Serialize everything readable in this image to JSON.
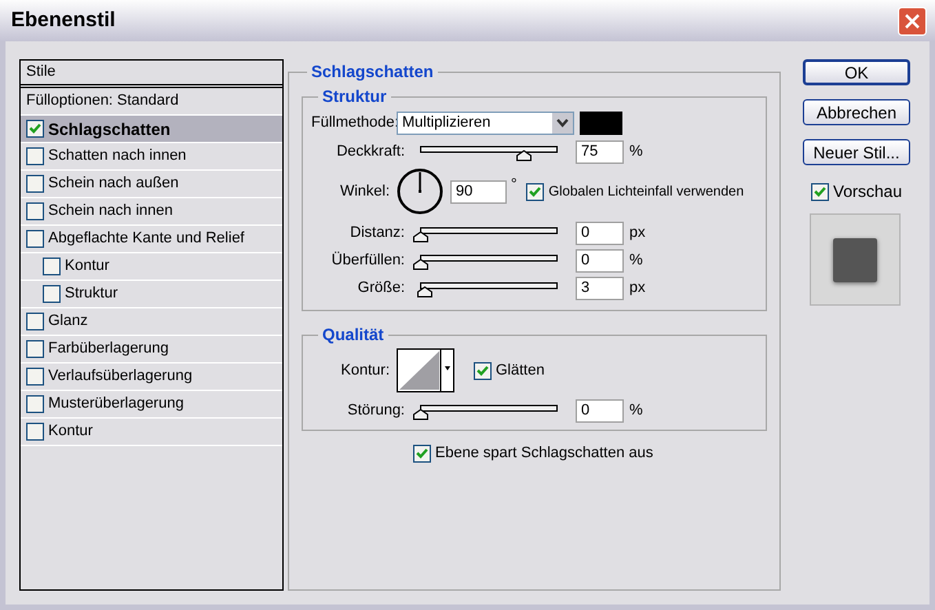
{
  "window": {
    "title": "Ebenenstil"
  },
  "styles_list": {
    "header": "Stile",
    "items": [
      {
        "kind": "plain",
        "label": "Fülloptionen: Standard",
        "selected": false
      },
      {
        "kind": "check",
        "label": "Schlagschatten",
        "checked": true,
        "selected": true
      },
      {
        "kind": "check",
        "label": "Schatten nach innen",
        "checked": false,
        "selected": false
      },
      {
        "kind": "check",
        "label": "Schein nach außen",
        "checked": false,
        "selected": false
      },
      {
        "kind": "check",
        "label": "Schein nach innen",
        "checked": false,
        "selected": false
      },
      {
        "kind": "check",
        "label": "Abgeflachte Kante und Relief",
        "checked": false,
        "selected": false,
        "children": [
          {
            "kind": "check",
            "label": "Kontur",
            "checked": false,
            "selected": false
          },
          {
            "kind": "check",
            "label": "Struktur",
            "checked": false,
            "selected": false
          }
        ]
      },
      {
        "kind": "check",
        "label": "Glanz",
        "checked": false,
        "selected": false
      },
      {
        "kind": "check",
        "label": "Farbüberlagerung",
        "checked": false,
        "selected": false
      },
      {
        "kind": "check",
        "label": "Verlaufsüberlagerung",
        "checked": false,
        "selected": false
      },
      {
        "kind": "check",
        "label": "Musterüberlagerung",
        "checked": false,
        "selected": false
      },
      {
        "kind": "check",
        "label": "Kontur",
        "checked": false,
        "selected": false
      }
    ]
  },
  "panel": {
    "title": "Schlagschatten",
    "structure": {
      "title": "Struktur",
      "blend_mode": {
        "label": "Füllmethode:",
        "value": "Multiplizieren",
        "color": "#000000"
      },
      "opacity": {
        "label": "Deckkraft:",
        "level": 0.75,
        "value": "75",
        "unit": "%"
      },
      "angle": {
        "label": "Winkel:",
        "value": "90",
        "unit": "°",
        "global_light": {
          "label": "Globalen Lichteinfall verwenden",
          "checked": true
        }
      },
      "sliders": [
        {
          "label": "Distanz:",
          "level": 0,
          "value": "0",
          "unit": "px"
        },
        {
          "label": "Überfüllen:",
          "level": 0,
          "value": "0",
          "unit": "%"
        },
        {
          "label": "Größe:",
          "level": 0.03,
          "value": "3",
          "unit": "px"
        }
      ]
    },
    "quality": {
      "title": "Qualität",
      "contour": {
        "label": "Kontur:"
      },
      "antialias": {
        "label": "Glätten",
        "checked": true
      },
      "noise": {
        "label": "Störung:",
        "level": 0,
        "value": "0",
        "unit": "%"
      }
    },
    "knockout": {
      "label": "Ebene spart Schlagschatten aus",
      "checked": true
    }
  },
  "buttons": [
    {
      "label": "OK",
      "default": true
    },
    {
      "label": "Abbrechen",
      "default": false
    },
    {
      "label": "Neuer Stil...",
      "default": false
    }
  ],
  "preview": {
    "label": "Vorschau",
    "checked": true
  }
}
